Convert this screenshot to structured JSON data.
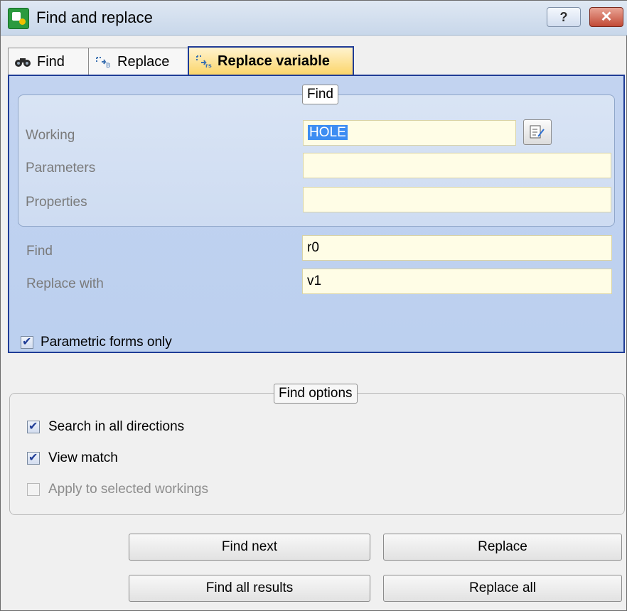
{
  "window": {
    "title": "Find and replace",
    "help_label": "?",
    "close_label": "✕"
  },
  "tabs": [
    {
      "label": "Find",
      "icon": "binoculars-icon",
      "active": false
    },
    {
      "label": "Replace",
      "icon": "replace-icon",
      "active": false
    },
    {
      "label": "Replace variable",
      "icon": "replace-variable-icon",
      "active": true
    }
  ],
  "find_group": {
    "legend": "Find",
    "working_label": "Working",
    "working_value": "HOLE",
    "parameters_label": "Parameters",
    "parameters_value": "",
    "properties_label": "Properties",
    "properties_value": ""
  },
  "replace": {
    "find_label": "Find",
    "find_value": "r0",
    "replace_label": "Replace with",
    "replace_value": "v1",
    "parametric_label": "Parametric forms only",
    "parametric_checked": true
  },
  "find_options": {
    "legend": "Find options",
    "items": [
      {
        "label": "Search in all directions",
        "checked": true,
        "enabled": true
      },
      {
        "label": "View match",
        "checked": true,
        "enabled": true
      },
      {
        "label": "Apply to selected workings",
        "checked": false,
        "enabled": false
      }
    ]
  },
  "buttons": {
    "find_next": "Find next",
    "replace": "Replace",
    "find_all": "Find all results",
    "replace_all": "Replace all"
  },
  "colors": {
    "panel_blue": "#bcd0ef",
    "active_tab": "#fbd56a",
    "input_bg": "#fffde6",
    "selection": "#3d8df2"
  }
}
